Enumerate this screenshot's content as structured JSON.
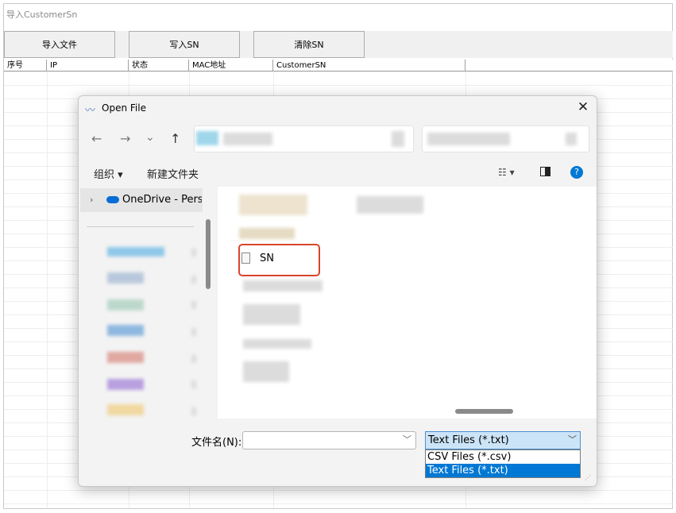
{
  "app": {
    "title": "导入CustomerSn",
    "buttons": {
      "import_file": "导入文件",
      "write_sn": "写入SN",
      "clear_sn": "清除SN"
    },
    "columns": [
      "序号",
      "IP",
      "状态",
      "MAC地址",
      "CustomerSN"
    ]
  },
  "dialog": {
    "title": "Open File",
    "close_glyph": "✕",
    "nav": {
      "back": "←",
      "forward": "→",
      "recent": "⌄",
      "up": "↑"
    },
    "command_bar": {
      "organize": "组织 ▾",
      "new_folder": "新建文件夹"
    },
    "nav_pane": {
      "onedrive": "OneDrive - Perso"
    },
    "files": [
      {
        "name": "SN",
        "icon": "text-file-icon"
      }
    ],
    "filename_label": "文件名(N):",
    "filename_value": "",
    "filter": {
      "selected": "Text Files (*.txt)",
      "options": [
        "CSV Files (*.csv)",
        "Text Files (*.txt)"
      ]
    }
  },
  "colors": {
    "accent": "#0078d4",
    "highlight_box": "#d9452b",
    "selected_filter_bg": "#cce4f7"
  }
}
